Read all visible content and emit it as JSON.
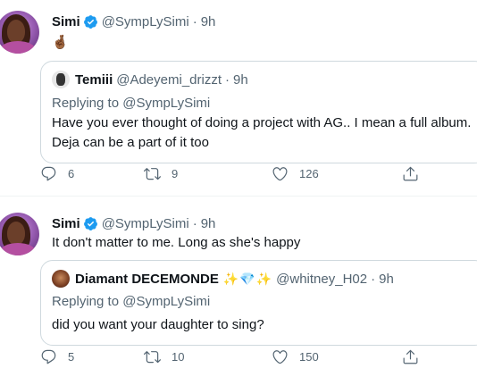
{
  "tweets": [
    {
      "author": {
        "name": "Simi",
        "handle": "@SympLySimi",
        "time": "9h",
        "verified": true
      },
      "text": "🤞🏾",
      "quote": {
        "name": "Temiii",
        "handle": "@Adeyemi_drizzt",
        "time": "9h",
        "replying_label": "Replying to",
        "replying_to": "@SympLySimi",
        "text_line1": "Have you ever thought of doing a project with AG.. I mean a full album.",
        "text_line2": "Deja can be a part of it too"
      },
      "actions": {
        "replies": "6",
        "retweets": "9",
        "likes": "126"
      }
    },
    {
      "author": {
        "name": "Simi",
        "handle": "@SympLySimi",
        "time": "9h",
        "verified": true
      },
      "text": "It don't matter to me. Long as she's happy",
      "quote": {
        "name": "Diamant DECEMONDE",
        "decoration": "✨💎✨",
        "handle": "@whitney_H02",
        "time": "9h",
        "replying_label": "Replying to",
        "replying_to": "@SympLySimi",
        "text_line1": "did you want your daughter to sing?"
      },
      "actions": {
        "replies": "5",
        "retweets": "10",
        "likes": "150"
      }
    }
  ],
  "separator": "·",
  "colors": {
    "verified": "#1d9bf0",
    "secondary_text": "#536471",
    "border": "#cfd9de"
  },
  "icons": [
    "reply-icon",
    "retweet-icon",
    "like-icon",
    "share-icon",
    "verified-badge-icon"
  ]
}
